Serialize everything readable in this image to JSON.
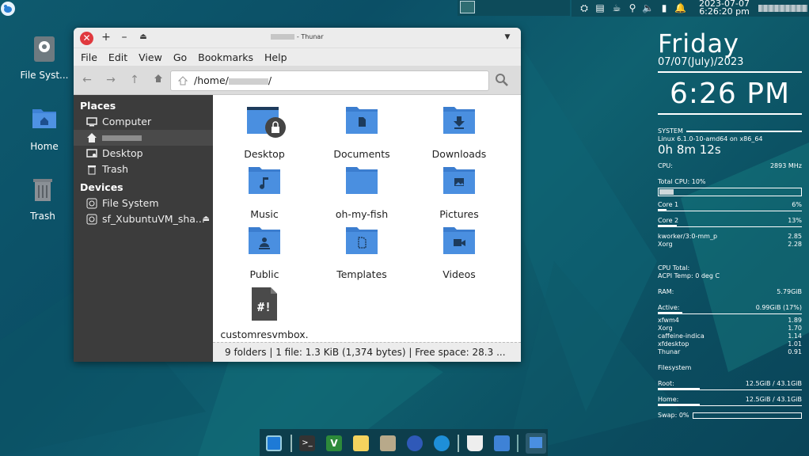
{
  "top_panel": {
    "clock_date": "2023-07-07",
    "clock_time": "6:26:20 pm"
  },
  "desktop_icons": [
    {
      "label": "File Syst..."
    },
    {
      "label": "Home"
    },
    {
      "label": "Trash"
    }
  ],
  "window": {
    "title_suffix": "- Thunar",
    "menu": [
      "File",
      "Edit",
      "View",
      "Go",
      "Bookmarks",
      "Help"
    ],
    "path_prefix": "/home/",
    "path_suffix": "/",
    "sidebar": {
      "places_header": "Places",
      "places": [
        "Computer",
        "",
        "Desktop",
        "Trash"
      ],
      "devices_header": "Devices",
      "devices": [
        "File System",
        "sf_XubuntuVM_sha..."
      ]
    },
    "files": [
      {
        "name": "Desktop"
      },
      {
        "name": "Documents"
      },
      {
        "name": "Downloads"
      },
      {
        "name": "Music"
      },
      {
        "name": "oh-my-fish"
      },
      {
        "name": "Pictures"
      },
      {
        "name": "Public"
      },
      {
        "name": "Templates"
      },
      {
        "name": "Videos"
      },
      {
        "name": "customresvmbox.sh"
      }
    ],
    "status": "9 folders  |  1 file: 1.3 KiB (1,374 bytes)  |  Free space: 28.3 ..."
  },
  "conky": {
    "day": "Friday",
    "date": "07/07(July)/2023",
    "time": "6:26 PM",
    "system_label": "SYSTEM",
    "kernel": "Linux 6.1.0-10-amd64 on x86_64",
    "uptime": "0h 8m 12s",
    "cpu_label": "CPU:",
    "cpu_freq": "2893 MHz",
    "total_cpu": "Total CPU: 10%",
    "total_cpu_pct": 10,
    "core1_label": "Core 1",
    "core1_val": "6%",
    "core1_pct": 6,
    "core2_label": "Core 2",
    "core2_val": "13%",
    "core2_pct": 13,
    "top_cpu": [
      {
        "name": "kworker/3:0-mm_p",
        "val": "2.85"
      },
      {
        "name": "Xorg",
        "val": "2.28"
      }
    ],
    "cpu_total_label": "CPU Total:",
    "acpi": "ACPI Temp: 0 deg C",
    "ram_label": "RAM:",
    "ram_val": "5.79GiB",
    "active_label": "Active:",
    "active_val": "0.99GiB (17%)",
    "active_pct": 17,
    "top_mem": [
      {
        "name": "xfwm4",
        "val": "1.89"
      },
      {
        "name": "Xorg",
        "val": "1.70"
      },
      {
        "name": "caffeine-indica",
        "val": "1.14"
      },
      {
        "name": "xfdesktop",
        "val": "1.01"
      },
      {
        "name": "Thunar",
        "val": "0.91"
      }
    ],
    "fs_label": "Filesystem",
    "root_label": "Root:",
    "root_val": "12.5GiB / 43.1GiB",
    "root_pct": 29,
    "home_label": "Home:",
    "home_val": "12.5GiB / 43.1GiB",
    "home_pct": 29,
    "swap_label": "Swap: 0%"
  }
}
